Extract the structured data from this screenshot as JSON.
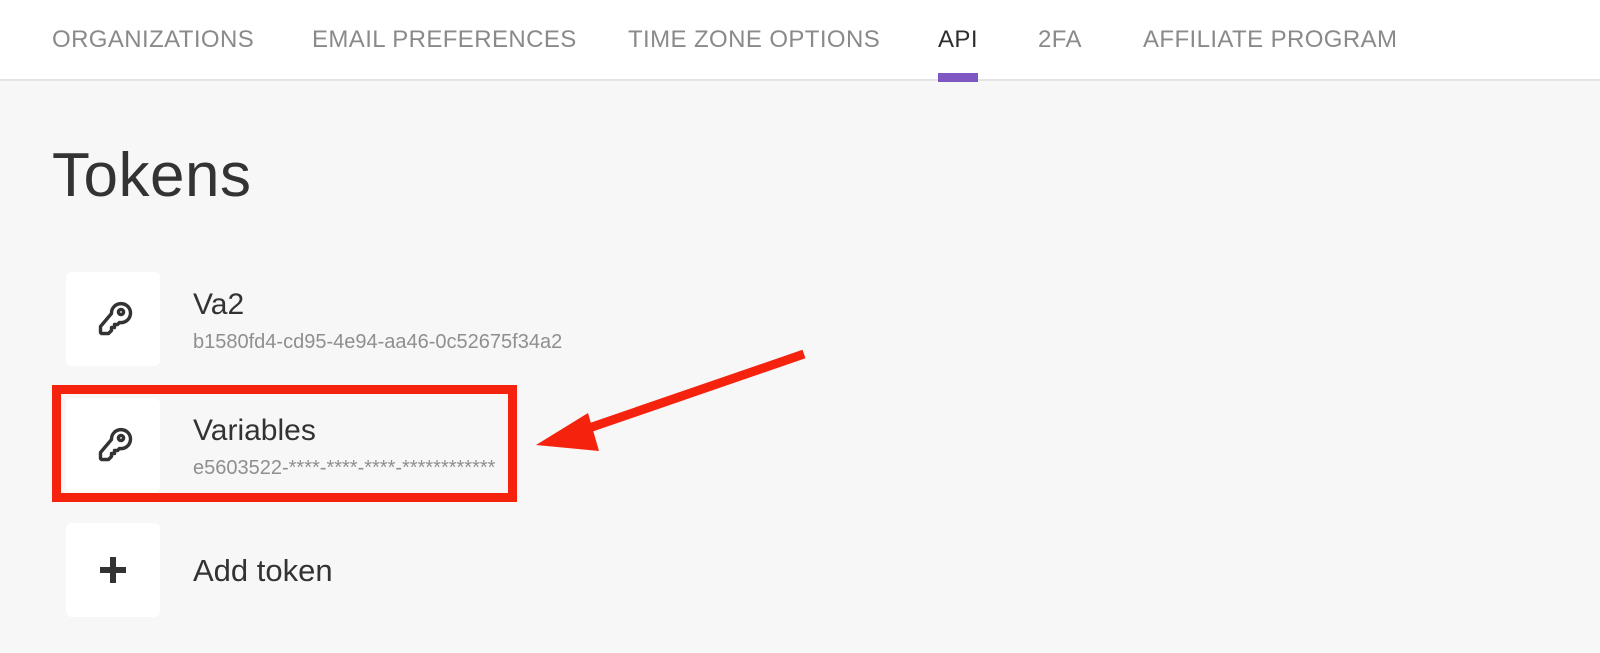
{
  "tabs": [
    {
      "label": "ORGANIZATIONS",
      "active": false
    },
    {
      "label": "EMAIL PREFERENCES",
      "active": false
    },
    {
      "label": "TIME ZONE OPTIONS",
      "active": false
    },
    {
      "label": "API",
      "active": true
    },
    {
      "label": "2FA",
      "active": false
    },
    {
      "label": "AFFILIATE PROGRAM",
      "active": false
    }
  ],
  "page": {
    "title": "Tokens"
  },
  "tokens": [
    {
      "name": "Va2",
      "id": "b1580fd4-cd95-4e94-aa46-0c52675f34a2",
      "icon": "key-icon"
    },
    {
      "name": "Variables",
      "id": "e5603522-****-****-****-************",
      "icon": "key-icon"
    }
  ],
  "add_token": {
    "label": "Add token",
    "icon": "plus-icon"
  },
  "colors": {
    "accent": "#7e57c2",
    "annotation": "#f5230e",
    "background": "#f7f7f7"
  }
}
